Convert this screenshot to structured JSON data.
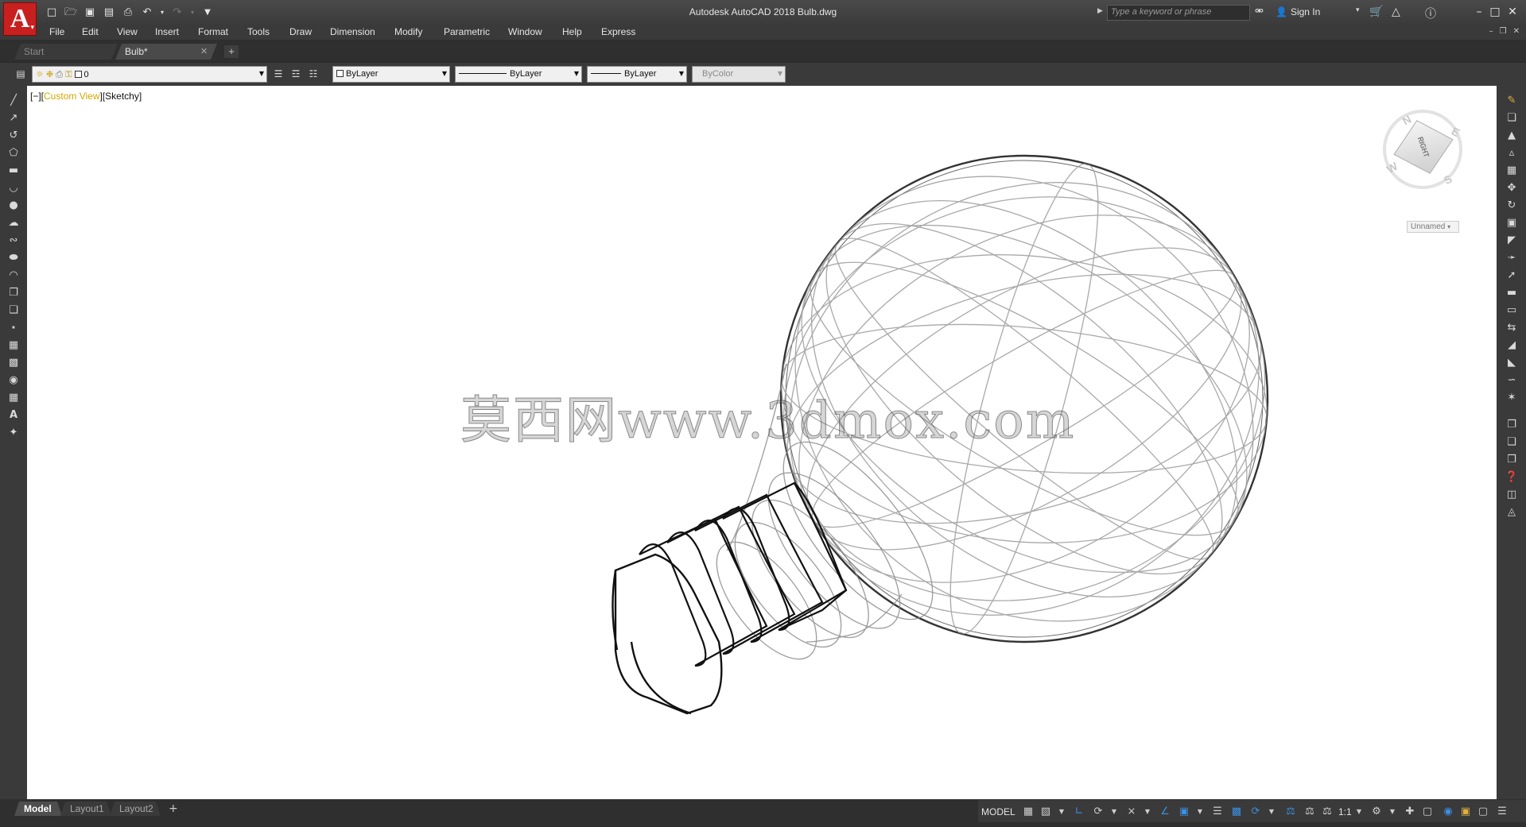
{
  "titlebar": {
    "app_letter": "A",
    "title": "Autodesk AutoCAD 2018    Bulb.dwg",
    "search_placeholder": "Type a keyword or phrase",
    "signin_label": "Sign In"
  },
  "menu": [
    "File",
    "Edit",
    "View",
    "Insert",
    "Format",
    "Tools",
    "Draw",
    "Dimension",
    "Modify",
    "Parametric",
    "Window",
    "Help",
    "Express"
  ],
  "file_tabs": {
    "start": "Start",
    "active": "Bulb*"
  },
  "properties": {
    "layer": "0",
    "color": "ByLayer",
    "linetype": "ByLayer",
    "lineweight": "ByLayer",
    "plotstyle": "ByColor"
  },
  "viewport": {
    "label_prefix": "[−][",
    "view_name": "Custom View",
    "label_mid": "][",
    "visual_style": "Sketchy",
    "label_suffix": "]",
    "watermark": "莫西网www.3dmox.com"
  },
  "viewcube": {
    "face_label": "RIGHT",
    "compass": {
      "n": "N",
      "e": "E",
      "s": "S",
      "w": "W"
    },
    "ucs_name": "Unnamed"
  },
  "layout_tabs": [
    "Model",
    "Layout1",
    "Layout2"
  ],
  "status": {
    "model_label": "MODEL",
    "annotation_scale": "1:1"
  },
  "colors": {
    "chrome_dark": "#2b2b2b",
    "chrome": "#3a3a3a",
    "app_red": "#c8201f",
    "viewport_bg": "#ffffff",
    "view_name_highlight": "#d4a700"
  }
}
